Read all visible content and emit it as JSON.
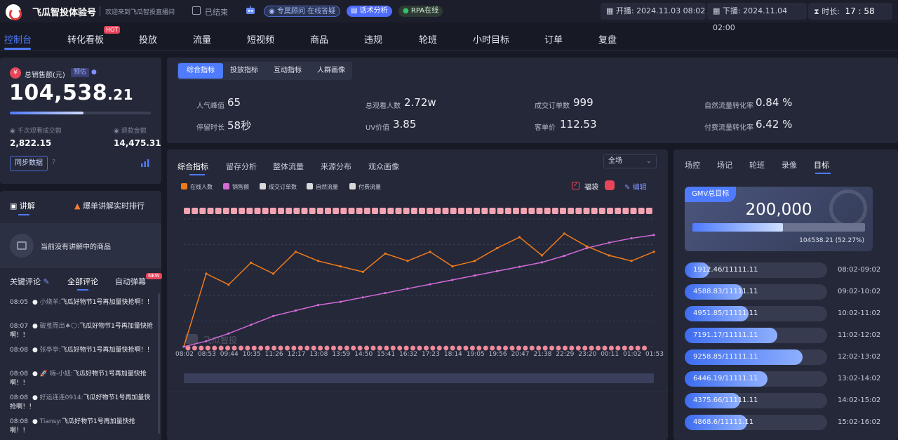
{
  "header": {
    "title": "飞瓜智投体验号",
    "welcome": "欢迎来到飞瓜智投直播间",
    "status": "已结束",
    "consultant": "专属顾问 在线答疑",
    "script_analysis": "话术分析",
    "rpa": "RPA在线",
    "start_label": "开播:",
    "start_time": "2024.11.03 08:02",
    "end_label": "下播:",
    "end_time": "2024.11.04 02:00",
    "duration_label": "时长:",
    "duration": "17 : 58"
  },
  "nav": {
    "items": [
      "控制台",
      "转化看板",
      "投放",
      "流量",
      "短视频",
      "商品",
      "违规",
      "轮班",
      "小时目标",
      "订单",
      "复盘"
    ],
    "hot_badge": "HOT"
  },
  "sales": {
    "label": "总销售额(元)",
    "estimate_badge": "预估",
    "value_int": "104,538",
    "value_dec": ".21",
    "progress": 0.52,
    "gpm_label": "千次观看成交额",
    "gpm_value": "2,822.15",
    "refund_label": "退款金额",
    "refund_value": "14,475.31",
    "sync_button": "同步数据"
  },
  "explain": {
    "tab_label": "讲解",
    "rank_label": "爆单讲解实时排行",
    "empty_text": "当前没有讲解中的商品"
  },
  "comments": {
    "tabs": [
      "关键评论",
      "全部评论",
      "自动弹幕"
    ],
    "new_badge": "NEW",
    "items": [
      {
        "time": "08:05",
        "user": "小烧羊:",
        "text": "飞瓜好物节1号再加量快抢啊！！"
      },
      {
        "time": "08:07",
        "user": "破茧而出♠🌕:",
        "text": "飞瓜好物节1号再加量快抢啊！！"
      },
      {
        "time": "08:08",
        "user": "张亭亭:",
        "text": "飞瓜好物节1号再加量快抢啊！！"
      },
      {
        "time": "08:08",
        "user": "🚀 嗨-小妞:",
        "text": "飞瓜好物节1号再加量快抢啊！！"
      },
      {
        "time": "08:08",
        "user": "好运连连0914:",
        "text": "飞瓜好物节1号再加量快抢啊！！"
      },
      {
        "time": "08:08",
        "user": "Tiansy:",
        "text": "飞瓜好物节1号再加量快抢啊！！"
      }
    ]
  },
  "metric_tabs": [
    "综合指标",
    "投放指标",
    "互动指标",
    "人群画像"
  ],
  "metrics": [
    {
      "label": "人气峰值",
      "value": "65"
    },
    {
      "label": "总观看人数",
      "value": "2.72w"
    },
    {
      "label": "成交订单数",
      "value": "999"
    },
    {
      "label": "自然流量转化率",
      "value": "0.84 %"
    },
    {
      "label": "停留时长",
      "value": "58秒"
    },
    {
      "label": "UV价值",
      "value": "3.85"
    },
    {
      "label": "客单价",
      "value": "112.53"
    },
    {
      "label": "付费流量转化率",
      "value": "6.42 %"
    }
  ],
  "chart_panel": {
    "tabs": [
      "综合指标",
      "留存分析",
      "整体流量",
      "来源分布",
      "观众画像"
    ],
    "scope_select": "全场",
    "lucky_bag_label": "福袋",
    "edit_label": "编辑",
    "legend": [
      {
        "name": "在线人数",
        "color": "#f07a1a"
      },
      {
        "name": "销售额",
        "color": "#d26ad8"
      },
      {
        "name": "成交订单数",
        "color": "#d9d9d9"
      },
      {
        "name": "自然流量",
        "color": "#d9d9d9"
      },
      {
        "name": "付费流量",
        "color": "#d9d9d9"
      }
    ],
    "watermark": "飞瓜智投"
  },
  "chart_data": {
    "type": "line",
    "x": [
      "08:02",
      "08:53",
      "09:44",
      "10:35",
      "11:26",
      "12:17",
      "13:08",
      "13:59",
      "14:50",
      "15:41",
      "16:32",
      "17:23",
      "18:14",
      "19:05",
      "19:56",
      "20:47",
      "21:38",
      "22:29",
      "23:20",
      "00:11",
      "01:02",
      "01:53"
    ],
    "series": [
      {
        "name": "在线人数",
        "color": "#f07a1a",
        "values": [
          0,
          40,
          34,
          46,
          40,
          52,
          47,
          44,
          41,
          51,
          47,
          52,
          44,
          47,
          54,
          60,
          50,
          62,
          55,
          50,
          47,
          52
        ]
      },
      {
        "name": "销售额",
        "color": "#d26ad8",
        "values": [
          0,
          5,
          12,
          20,
          28,
          33,
          38,
          41,
          45,
          49,
          53,
          57,
          61,
          65,
          69,
          73,
          77,
          83,
          90,
          95,
          99,
          102
        ]
      }
    ],
    "ylim": [
      0,
      70
    ]
  },
  "right_panel": {
    "tabs": [
      "场控",
      "场记",
      "轮班",
      "录像",
      "目标"
    ],
    "gmv_label": "GMV总目标",
    "gmv_target": "200,000",
    "gmv_progress_text": "104538.21  (52.27%)",
    "gmv_progress": 0.5227,
    "hourly": [
      {
        "text": "1912.46/11111.11",
        "time": "08:02-09:02",
        "fraction": 0.17
      },
      {
        "text": "4588.83/11111.11",
        "time": "09:02-10:02",
        "fraction": 0.41
      },
      {
        "text": "4951.85/11111.11",
        "time": "10:02-11:02",
        "fraction": 0.45
      },
      {
        "text": "7191.17/11111.11",
        "time": "11:02-12:02",
        "fraction": 0.65
      },
      {
        "text": "9258.85/11111.11",
        "time": "12:02-13:02",
        "fraction": 0.83
      },
      {
        "text": "6446.19/11111.11",
        "time": "13:02-14:02",
        "fraction": 0.58
      },
      {
        "text": "4375.66/11111.11",
        "time": "14:02-15:02",
        "fraction": 0.39
      },
      {
        "text": "4868.6/11111.11",
        "time": "15:02-16:02",
        "fraction": 0.44
      }
    ]
  }
}
